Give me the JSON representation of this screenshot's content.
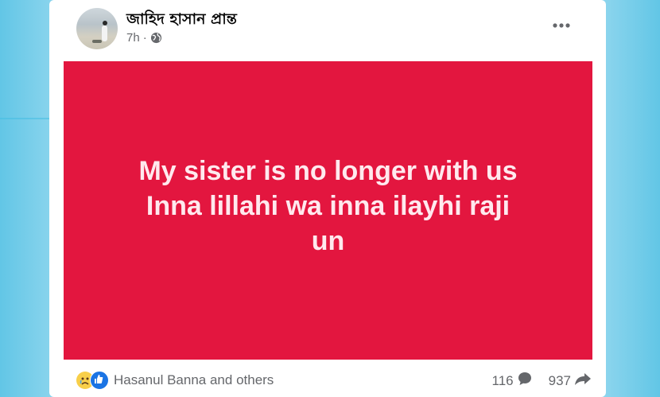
{
  "post": {
    "author": "জাহিদ হাসান প্রান্ত",
    "time": "7h",
    "separator": "·",
    "message_lines": [
      "My sister is no longer with us",
      "Inna lillahi wa inna ilayhi raji",
      "un"
    ],
    "background_color": "#e3163f"
  },
  "footer": {
    "reaction_icons": [
      "sad-icon",
      "like-icon"
    ],
    "reactors": "Hasanul Banna and others",
    "comment_count": "116",
    "share_count": "937"
  }
}
